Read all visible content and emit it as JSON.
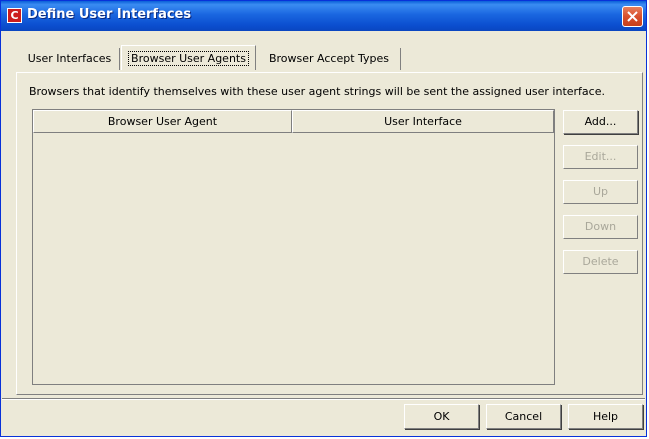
{
  "window": {
    "title": "Define User Interfaces",
    "app_icon_glyph": "C",
    "close_icon": "close-icon"
  },
  "tabs": [
    {
      "label": "User Interfaces",
      "active": false
    },
    {
      "label": "Browser User Agents",
      "active": true
    },
    {
      "label": "Browser Accept Types",
      "active": false
    }
  ],
  "description": "Browsers that identify themselves with these user agent strings will be sent the assigned user interface.",
  "table": {
    "columns": [
      "Browser User Agent",
      "User Interface"
    ],
    "rows": []
  },
  "side_buttons": {
    "add": "Add...",
    "edit": "Edit...",
    "up": "Up",
    "down": "Down",
    "delete": "Delete"
  },
  "footer_buttons": {
    "ok": "OK",
    "cancel": "Cancel",
    "help": "Help"
  },
  "colors": {
    "titlebar": "#0a5fd8",
    "window_bg": "#ece9d8",
    "close_button": "#d9502d",
    "app_icon": "#cc1d1d",
    "disabled_text": "#a9a79a"
  }
}
